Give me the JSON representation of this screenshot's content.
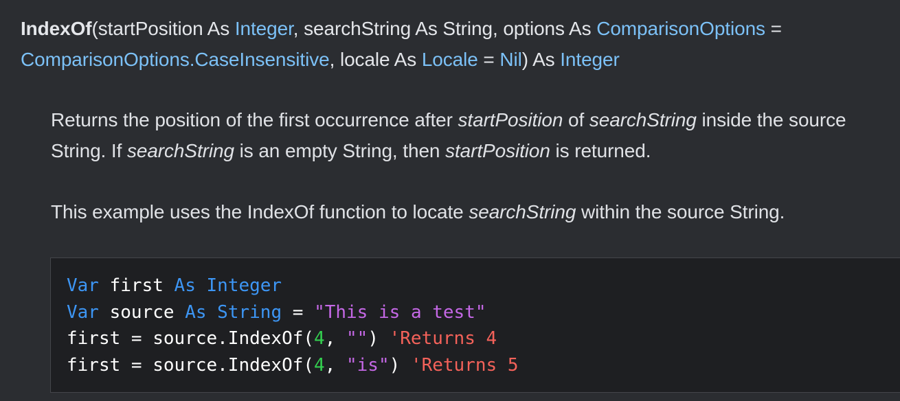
{
  "signature": {
    "name": "IndexOf",
    "p_open": "(startPosition As ",
    "t_integer": "Integer",
    "p_mid1": ", searchString As String, options As ",
    "t_compopts": "ComparisonOptions",
    "p_eq1": " = ",
    "t_caseins": "ComparisonOptions.CaseInsensitive",
    "p_mid2": ", locale As ",
    "t_locale": "Locale",
    "p_eq2": " = ",
    "t_nil": "Nil",
    "p_ret": ") As ",
    "t_integer_ret": "Integer"
  },
  "description": {
    "s1": "Returns the position of the first occurrence after ",
    "i1": "startPosition",
    "s2": " of ",
    "i2": "searchString",
    "s3": " inside the source String. If ",
    "i3": "searchString",
    "s4": " is an empty String, then ",
    "i4": "startPosition",
    "s5": " is returned."
  },
  "example_intro": {
    "s1": "This example uses the IndexOf function to locate ",
    "i1": "searchString",
    "s2": " within the source String."
  },
  "code": {
    "l1": {
      "kw1": "Var",
      "t1": " first ",
      "kw2": "As",
      "sp": " ",
      "kw3": "Integer"
    },
    "l2": {
      "kw1": "Var",
      "t1": " source ",
      "kw2": "As",
      "sp": " ",
      "kw3": "String",
      "t2": " = ",
      "str": "\"This is a test\""
    },
    "l3": {
      "t1": "first = source.IndexOf(",
      "num": "4",
      "t2": ", ",
      "str": "\"\"",
      "t3": ") ",
      "cmt": "'Returns 4"
    },
    "l4": {
      "t1": "first = source.IndexOf(",
      "num": "4",
      "t2": ", ",
      "str": "\"is\"",
      "t3": ") ",
      "cmt": "'Returns 5"
    }
  },
  "colors": {
    "background": "#2b2d31",
    "link": "#7cc1f7",
    "keyword": "#3d96f5",
    "string": "#c568e6",
    "number": "#33cf4f",
    "comment": "#f4625a"
  }
}
